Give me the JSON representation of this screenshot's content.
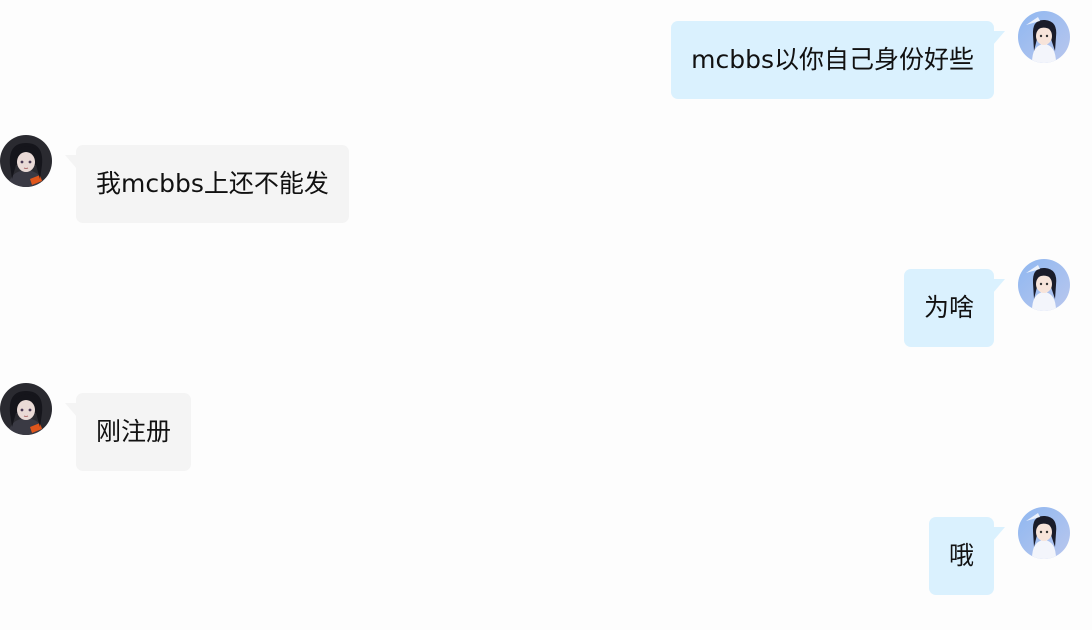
{
  "messages": [
    {
      "direction": "outgoing",
      "text": "mcbbs以你自己身份好些"
    },
    {
      "direction": "incoming",
      "text": "我mcbbs上还不能发"
    },
    {
      "direction": "outgoing",
      "text": "为啥"
    },
    {
      "direction": "incoming",
      "text": "刚注册"
    },
    {
      "direction": "outgoing",
      "text": "哦"
    }
  ],
  "colors": {
    "outgoing_bubble": "#daf1fe",
    "incoming_bubble": "#f4f4f4",
    "background": "#fdfdfd"
  },
  "icons": {
    "outgoing_avatar": "anime-girl-avatar",
    "incoming_avatar": "dark-haired-girl-avatar"
  }
}
